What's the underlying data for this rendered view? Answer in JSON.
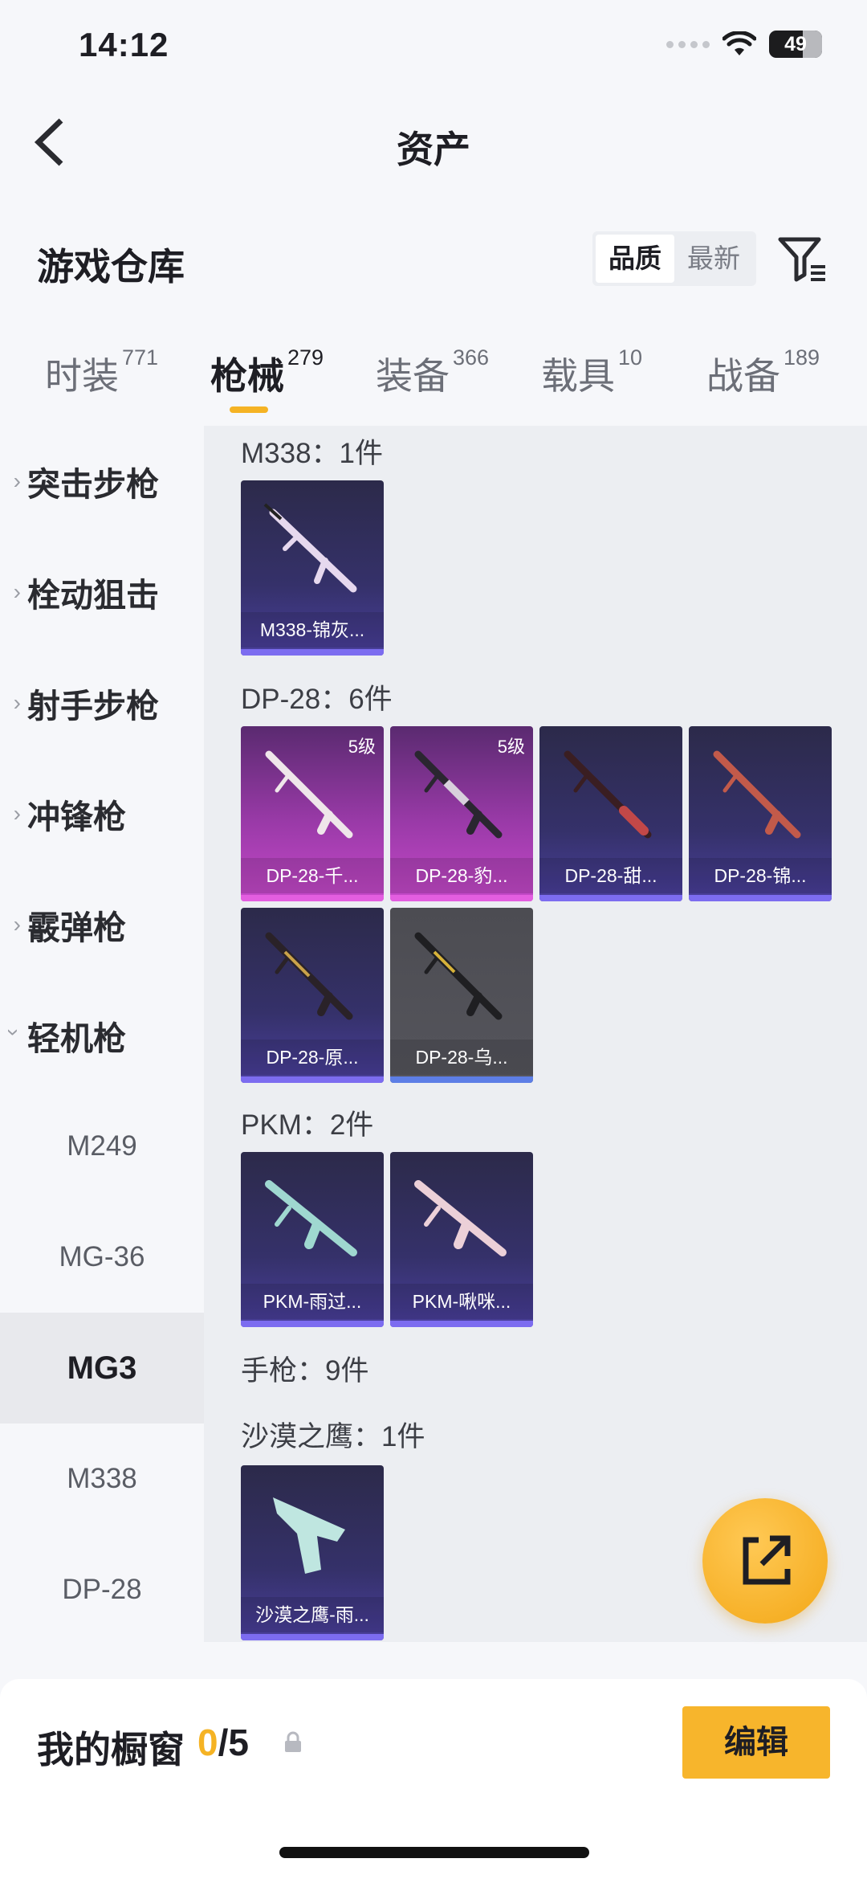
{
  "status_bar": {
    "time": "14:12",
    "battery": "49"
  },
  "header": {
    "title": "资产"
  },
  "warehouse": {
    "title": "游戏仓库",
    "sort_options": [
      "品质",
      "最新"
    ],
    "active_sort": "品质"
  },
  "tabs": [
    {
      "label": "时装",
      "count": "771"
    },
    {
      "label": "枪械",
      "count": "279",
      "active": true
    },
    {
      "label": "装备",
      "count": "366"
    },
    {
      "label": "载具",
      "count": "10"
    },
    {
      "label": "战备",
      "count": "189"
    }
  ],
  "sidebar": {
    "categories": [
      "突击步枪",
      "栓动狙击",
      "射手步枪",
      "冲锋枪",
      "霰弹枪",
      "轻机枪"
    ],
    "subitems": [
      "M249",
      "MG-36",
      "MG3",
      "M338",
      "DP-28"
    ],
    "active_subitem": "MG3"
  },
  "groups": [
    {
      "title": "M338：1件",
      "items": [
        {
          "name": "M338-锦灰...",
          "level": "",
          "rarity": "purple"
        }
      ]
    },
    {
      "title": "DP-28：6件",
      "items": [
        {
          "name": "DP-28-千...",
          "level": "5级",
          "rarity": "pink"
        },
        {
          "name": "DP-28-豹...",
          "level": "5级",
          "rarity": "pink"
        },
        {
          "name": "DP-28-甜...",
          "level": "",
          "rarity": "purple"
        },
        {
          "name": "DP-28-锦...",
          "level": "",
          "rarity": "purple"
        },
        {
          "name": "DP-28-原...",
          "level": "",
          "rarity": "purple"
        },
        {
          "name": "DP-28-乌...",
          "level": "",
          "rarity": "gray"
        }
      ]
    },
    {
      "title": "PKM：2件",
      "items": [
        {
          "name": "PKM-雨过...",
          "level": "",
          "rarity": "purple"
        },
        {
          "name": "PKM-啾咪...",
          "level": "",
          "rarity": "purple"
        }
      ]
    },
    {
      "title": "手枪：9件",
      "items": []
    },
    {
      "title": "沙漠之鹰：1件",
      "items": [
        {
          "name": "沙漠之鹰-雨...",
          "level": "",
          "rarity": "purple"
        }
      ]
    }
  ],
  "showcase": {
    "label": "我的橱窗",
    "current": "0",
    "total": "/5",
    "edit_label": "编辑"
  },
  "colors": {
    "accent": "#f5b324",
    "purple_rarity": "#7c6cf0",
    "pink_rarity": "#e35ee0"
  },
  "icons": [
    "back-arrow-icon",
    "filter-icon",
    "wifi-icon",
    "lock-icon",
    "share-icon",
    "chevron-right-icon",
    "chevron-down-icon"
  ]
}
